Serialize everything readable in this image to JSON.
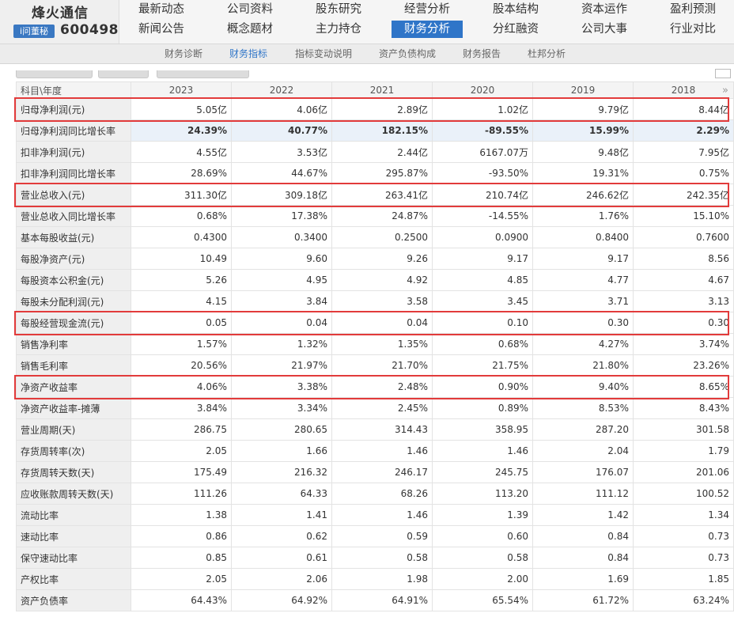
{
  "company": {
    "name": "烽火通信",
    "ask_button": "i问董秘",
    "code": "600498"
  },
  "nav": {
    "row1": [
      "最新动态",
      "公司资料",
      "股东研究",
      "经营分析",
      "股本结构",
      "资本运作",
      "盈利预测"
    ],
    "row2": [
      "新闻公告",
      "概念题材",
      "主力持仓",
      "财务分析",
      "分红融资",
      "公司大事",
      "行业对比"
    ],
    "active": "财务分析"
  },
  "subnav": {
    "items": [
      "财务诊断",
      "财务指标",
      "指标变动说明",
      "资产负债构成",
      "财务报告",
      "杜邦分析"
    ],
    "active": "财务指标"
  },
  "table": {
    "header_label": "科目\\年度",
    "years": [
      "2023",
      "2022",
      "2021",
      "2020",
      "2019",
      "2018"
    ],
    "more_icon": "double-chevron-right-icon",
    "rows": [
      {
        "label": "归母净利润(元)",
        "values": [
          "5.05亿",
          "4.06亿",
          "2.89亿",
          "1.02亿",
          "9.79亿",
          "8.44亿"
        ],
        "highlight": true
      },
      {
        "label": "归母净利润同比增长率",
        "values": [
          "24.39%",
          "40.77%",
          "182.15%",
          "-89.55%",
          "15.99%",
          "2.29%"
        ],
        "bold": true
      },
      {
        "label": "扣非净利润(元)",
        "values": [
          "4.55亿",
          "3.53亿",
          "2.44亿",
          "6167.07万",
          "9.48亿",
          "7.95亿"
        ]
      },
      {
        "label": "扣非净利润同比增长率",
        "values": [
          "28.69%",
          "44.67%",
          "295.87%",
          "-93.50%",
          "19.31%",
          "0.75%"
        ]
      },
      {
        "label": "营业总收入(元)",
        "values": [
          "311.30亿",
          "309.18亿",
          "263.41亿",
          "210.74亿",
          "246.62亿",
          "242.35亿"
        ],
        "highlight": true
      },
      {
        "label": "营业总收入同比增长率",
        "values": [
          "0.68%",
          "17.38%",
          "24.87%",
          "-14.55%",
          "1.76%",
          "15.10%"
        ]
      },
      {
        "label": "基本每股收益(元)",
        "values": [
          "0.4300",
          "0.3400",
          "0.2500",
          "0.0900",
          "0.8400",
          "0.7600"
        ]
      },
      {
        "label": "每股净资产(元)",
        "values": [
          "10.49",
          "9.60",
          "9.26",
          "9.17",
          "9.17",
          "8.56"
        ]
      },
      {
        "label": "每股资本公积金(元)",
        "values": [
          "5.26",
          "4.95",
          "4.92",
          "4.85",
          "4.77",
          "4.67"
        ]
      },
      {
        "label": "每股未分配利润(元)",
        "values": [
          "4.15",
          "3.84",
          "3.58",
          "3.45",
          "3.71",
          "3.13"
        ]
      },
      {
        "label": "每股经营现金流(元)",
        "values": [
          "0.05",
          "0.04",
          "0.04",
          "0.10",
          "0.30",
          "0.30"
        ],
        "highlight": true
      },
      {
        "label": "销售净利率",
        "values": [
          "1.57%",
          "1.32%",
          "1.35%",
          "0.68%",
          "4.27%",
          "3.74%"
        ]
      },
      {
        "label": "销售毛利率",
        "values": [
          "20.56%",
          "21.97%",
          "21.70%",
          "21.75%",
          "21.80%",
          "23.26%"
        ]
      },
      {
        "label": "净资产收益率",
        "values": [
          "4.06%",
          "3.38%",
          "2.48%",
          "0.90%",
          "9.40%",
          "8.65%"
        ],
        "highlight": true
      },
      {
        "label": "净资产收益率-摊薄",
        "values": [
          "3.84%",
          "3.34%",
          "2.45%",
          "0.89%",
          "8.53%",
          "8.43%"
        ]
      },
      {
        "label": "营业周期(天)",
        "values": [
          "286.75",
          "280.65",
          "314.43",
          "358.95",
          "287.20",
          "301.58"
        ]
      },
      {
        "label": "存货周转率(次)",
        "values": [
          "2.05",
          "1.66",
          "1.46",
          "1.46",
          "2.04",
          "1.79"
        ]
      },
      {
        "label": "存货周转天数(天)",
        "values": [
          "175.49",
          "216.32",
          "246.17",
          "245.75",
          "176.07",
          "201.06"
        ]
      },
      {
        "label": "应收账款周转天数(天)",
        "values": [
          "111.26",
          "64.33",
          "68.26",
          "113.20",
          "111.12",
          "100.52"
        ]
      },
      {
        "label": "流动比率",
        "values": [
          "1.38",
          "1.41",
          "1.46",
          "1.39",
          "1.42",
          "1.34"
        ]
      },
      {
        "label": "速动比率",
        "values": [
          "0.86",
          "0.62",
          "0.59",
          "0.60",
          "0.84",
          "0.73"
        ]
      },
      {
        "label": "保守速动比率",
        "values": [
          "0.85",
          "0.61",
          "0.58",
          "0.58",
          "0.84",
          "0.73"
        ]
      },
      {
        "label": "产权比率",
        "values": [
          "2.05",
          "2.06",
          "1.98",
          "2.00",
          "1.69",
          "1.85"
        ]
      },
      {
        "label": "资产负债率",
        "values": [
          "64.43%",
          "64.92%",
          "64.91%",
          "65.54%",
          "61.72%",
          "63.24%"
        ]
      }
    ]
  },
  "colors": {
    "accent": "#2f75c8",
    "highlight_border": "#e23b3b",
    "growth_row_bg": "#eaf1f9"
  }
}
